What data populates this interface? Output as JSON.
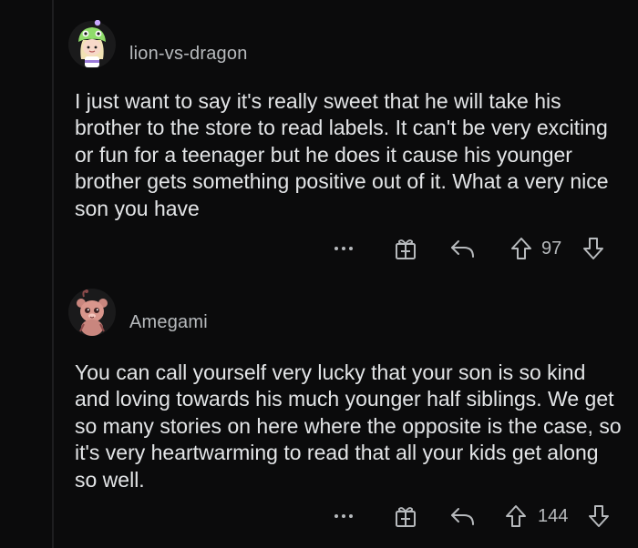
{
  "comments": [
    {
      "username": "lion-vs-dragon",
      "body": "I just want to say it's really sweet that he will take his brother to the store to read labels. It can't be very exciting or fun for a teenager but he does it cause his younger brother gets something positive out of it. What a very nice son you have",
      "score": "97",
      "avatar_icon": "snoo-avatar-green-hat-icon"
    },
    {
      "username": "Amegami",
      "body": "You can call yourself very lucky that your son is so kind and loving towards his much younger half siblings. We get so many stories on here where the opposite is the case, so it's very heartwarming to read that all your kids get along so well.",
      "score": "144",
      "avatar_icon": "snoo-avatar-pink-bear-icon"
    }
  ],
  "icons": {
    "more": "more-options-icon",
    "award": "award-gift-icon",
    "reply": "reply-arrow-icon",
    "upvote": "upvote-arrow-icon",
    "downvote": "downvote-arrow-icon"
  },
  "colors": {
    "background": "#0b0b0c",
    "text": "#e3e5e7",
    "muted": "#b7babd",
    "thread_line": "#1e1e20"
  }
}
